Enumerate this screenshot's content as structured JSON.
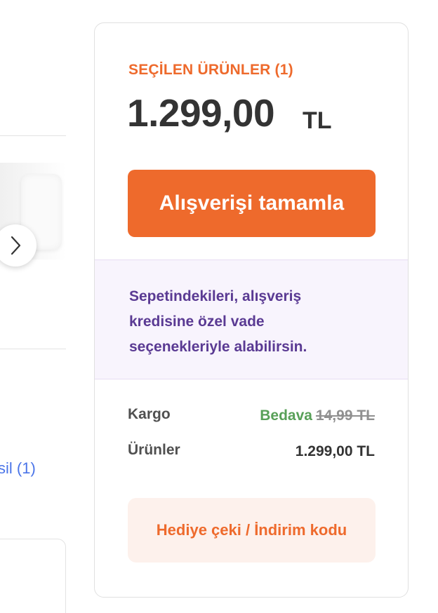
{
  "left": {
    "more_link": "sil (1)"
  },
  "summary": {
    "selected_title": "SEÇİLEN ÜRÜNLER (1)",
    "total_amount": "1.299,00",
    "total_currency": "TL",
    "checkout_label": "Alışverişi tamamla",
    "credit_text": "Sepetindekileri, alışveriş kredisine özel vade seçenekleriyle alabilirsin.",
    "shipping_label": "Kargo",
    "shipping_free": "Bedava",
    "shipping_old_price": "14,99 TL",
    "products_label": "Ürünler",
    "products_value": "1.299,00 TL",
    "gift_label": "Hediye çeki / İndirim kodu"
  },
  "colors": {
    "accent": "#ee6a2c",
    "credit_text": "#5a3a93",
    "credit_bg": "#f8f4fd",
    "free": "#58a058",
    "link": "#4a74e8"
  },
  "icons": {
    "carousel_next": "chevron-right-icon"
  }
}
